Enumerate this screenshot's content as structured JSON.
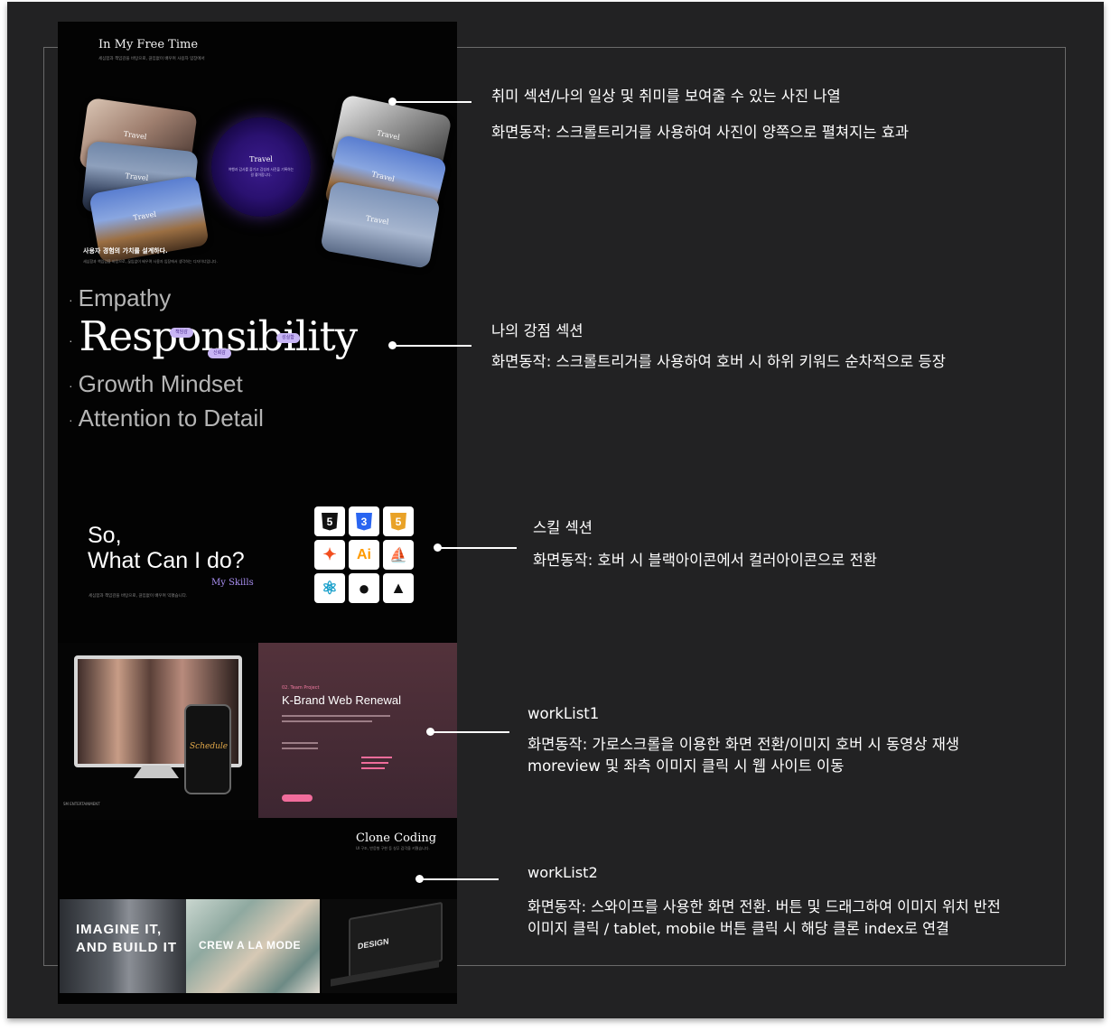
{
  "hobby": {
    "title": "In My Free Time",
    "subtitle": "세심함과 책임감을 바탕으로, 끊임없이 배우며 사용자 입장에서",
    "card_label": "Travel",
    "orb_title": "Travel",
    "orb_text": "여행과 감사를 즐기고 감성과 사진을 기록하는 걸 좋아합니다.",
    "heading": "사용자 경험의 가치를 설계하다.",
    "desc": "세심함과 책임감을 바탕으로, 끊임없이 배우며 사용자 입장에서 생각하는 디자이너입니다."
  },
  "strengths": {
    "keywords": [
      "Empathy",
      "Responsibility",
      "Growth Mindset",
      "Attention to Detail"
    ],
    "tags": [
      "책임감",
      "신뢰감",
      "성실함"
    ]
  },
  "skills": {
    "heading_line1": "So,",
    "heading_line2": "What Can I do?",
    "sub": "My Skills",
    "desc": "세심함과 책임감을 바탕으로, 끊임없이 배우며 익혔습니다.",
    "icons": [
      {
        "name": "html5-icon",
        "glyph": "5",
        "color": "#111111"
      },
      {
        "name": "css3-icon",
        "glyph": "3",
        "color": "#2965f1"
      },
      {
        "name": "javascript-icon",
        "glyph": "5",
        "color": "#e9a227"
      },
      {
        "name": "figma-icon",
        "glyph": "✦",
        "color": "#f24e1e"
      },
      {
        "name": "illustrator-icon",
        "glyph": "Ai",
        "color": "#ff9a00"
      },
      {
        "name": "sailboat-icon",
        "glyph": "⛵",
        "color": "#2d6cdf"
      },
      {
        "name": "react-icon",
        "glyph": "⚛",
        "color": "#149eca"
      },
      {
        "name": "github-icon",
        "glyph": "●",
        "color": "#111111"
      },
      {
        "name": "vercel-icon",
        "glyph": "▲",
        "color": "#111111"
      }
    ]
  },
  "worklist1": {
    "screen_title": "Schedule",
    "ent_label": "SM ENTERTAINMENT",
    "project_small": "02. Team Project",
    "project_title": "K-Brand Web Renewal"
  },
  "worklist2": {
    "title": "Clone Coding",
    "subtitle": "UI 구조, 반응형 구현 등 실무 감각을 키웠습니다.",
    "card1": "IMAGINE IT,\nAND BUILD IT",
    "card2": "CREW A LA MODE",
    "card3": "DESIGN"
  },
  "annotations": {
    "hobby_1": "취미 섹션/나의 일상 및 취미를 보여줄 수 있는 사진 나열",
    "hobby_2": "화면동작: 스크롤트리거를 사용하여 사진이 양쪽으로 펼쳐지는 효과",
    "strength_1": "나의 강점 섹션",
    "strength_2": "화면동작: 스크롤트리거를 사용하여 호버 시 하위 키워드 순차적으로 등장",
    "skill_1": "스킬 섹션",
    "skill_2": "화면동작: 호버 시 블랙아이콘에서 컬러아이콘으로 전환",
    "work1_1": "workList1",
    "work1_2": "화면동작: 가로스크롤을 이용한 화면 전환/이미지 호버 시 동영상 재생",
    "work1_3": "moreview 및 좌측 이미지 클릭 시 웹 사이트 이동",
    "work2_1": "workList2",
    "work2_2": "화면동작: 스와이프를 사용한 화면 전환. 버튼 및 드래그하여 이미지 위치 반전",
    "work2_3": "이미지 클릭 / tablet, mobile 버튼 클릭 시 해당 클론 index로 연결"
  }
}
